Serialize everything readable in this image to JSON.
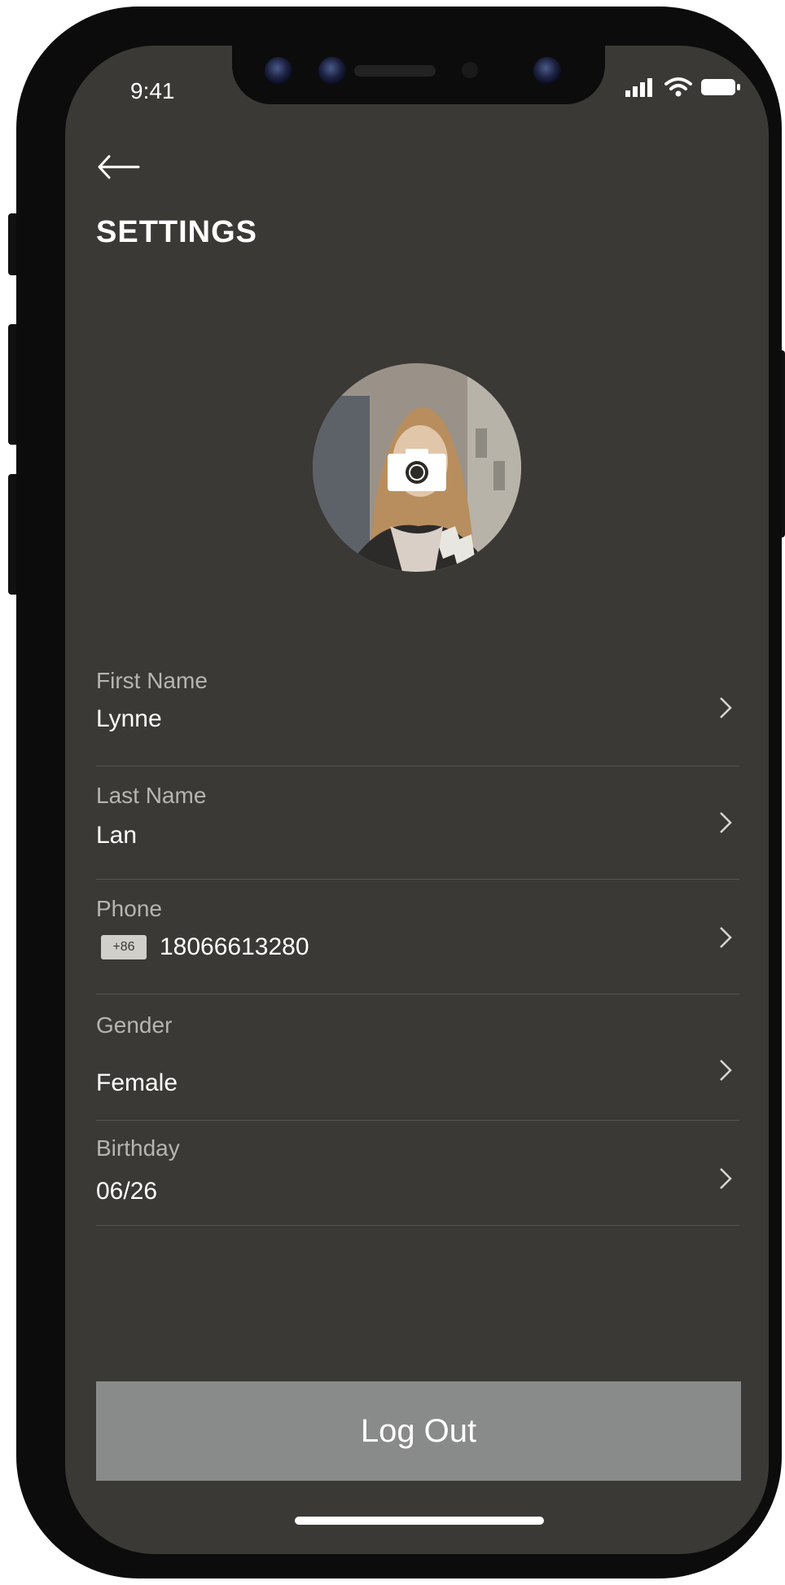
{
  "status_bar": {
    "time": "9:41"
  },
  "header": {
    "title": "SETTINGS"
  },
  "fields": [
    {
      "label": "First Name",
      "value": "Lynne"
    },
    {
      "label": "Last Name",
      "value": "Lan"
    },
    {
      "label": "Phone",
      "country_code": "+86",
      "value": "18066613280"
    },
    {
      "label": "Gender",
      "value": "Female"
    },
    {
      "label": "Birthday",
      "value": "06/26"
    }
  ],
  "logout": {
    "label": "Log Out"
  },
  "colors": {
    "background": "#3a3935",
    "button": "#898b8a",
    "text": "#ffffff",
    "label": "#b6b5b0"
  },
  "icons": [
    "back-arrow-icon",
    "camera-icon",
    "chevron-right-icon",
    "signal-icon",
    "wifi-icon",
    "battery-icon"
  ]
}
